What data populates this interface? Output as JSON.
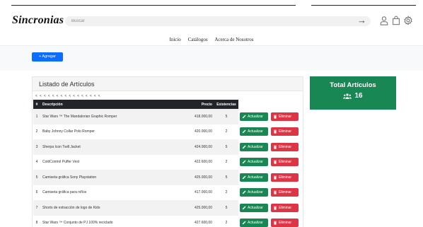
{
  "header": {
    "logo": "Sincronias",
    "search": {
      "placeholder": "Buscar",
      "value": ""
    },
    "icons": [
      "arrow-right-icon",
      "user-icon",
      "cart-icon",
      "gear-icon"
    ]
  },
  "nav": {
    "items": [
      "Inicio",
      "Catálogos",
      "Acerca de Nosotros"
    ]
  },
  "toolbar": {
    "add_label": "+ Agregar"
  },
  "panel": {
    "title": "Listado de Artículos",
    "dashes": "< < < < < < < < < < < < < < < <",
    "columns": [
      "#",
      "Descripción",
      "Precio",
      "Existencias"
    ],
    "rows": [
      {
        "n": "1",
        "desc": "Star Wars ™ The Mandalorian Graphic Romper",
        "price": "418.000,00",
        "stock": "5"
      },
      {
        "n": "2",
        "desc": "Baby Johnny Collar Polo Romper",
        "price": "420.000,00",
        "stock": "2"
      },
      {
        "n": "3",
        "desc": "Sherpa Icon Twill Jacket",
        "price": "424.000,00",
        "stock": "5"
      },
      {
        "n": "4",
        "desc": "ColdControl Puffer Vest",
        "price": "422.600,00",
        "stock": "2"
      },
      {
        "n": "5",
        "desc": "Camiseta gráfica Sony Playstation",
        "price": "425.000,00",
        "stock": "5"
      },
      {
        "n": "6",
        "desc": "Camiseta gráfica para niños",
        "price": "417.000,00",
        "stock": "2"
      },
      {
        "n": "7",
        "desc": "Shorts de extracción de logo de Kids",
        "price": "425.000,00",
        "stock": "5"
      },
      {
        "n": "8",
        "desc": "Star Wars ™ Conjunto de PJ 100% reciclado",
        "price": "427.600,00",
        "stock": "2"
      }
    ],
    "update_label": "Actualizar",
    "delete_label": "Eliminar"
  },
  "total": {
    "title": "Total Artículos",
    "value": "16"
  },
  "colors": {
    "primary": "#0d6efd",
    "success": "#198754",
    "danger": "#dc3545",
    "dark": "#212529"
  }
}
